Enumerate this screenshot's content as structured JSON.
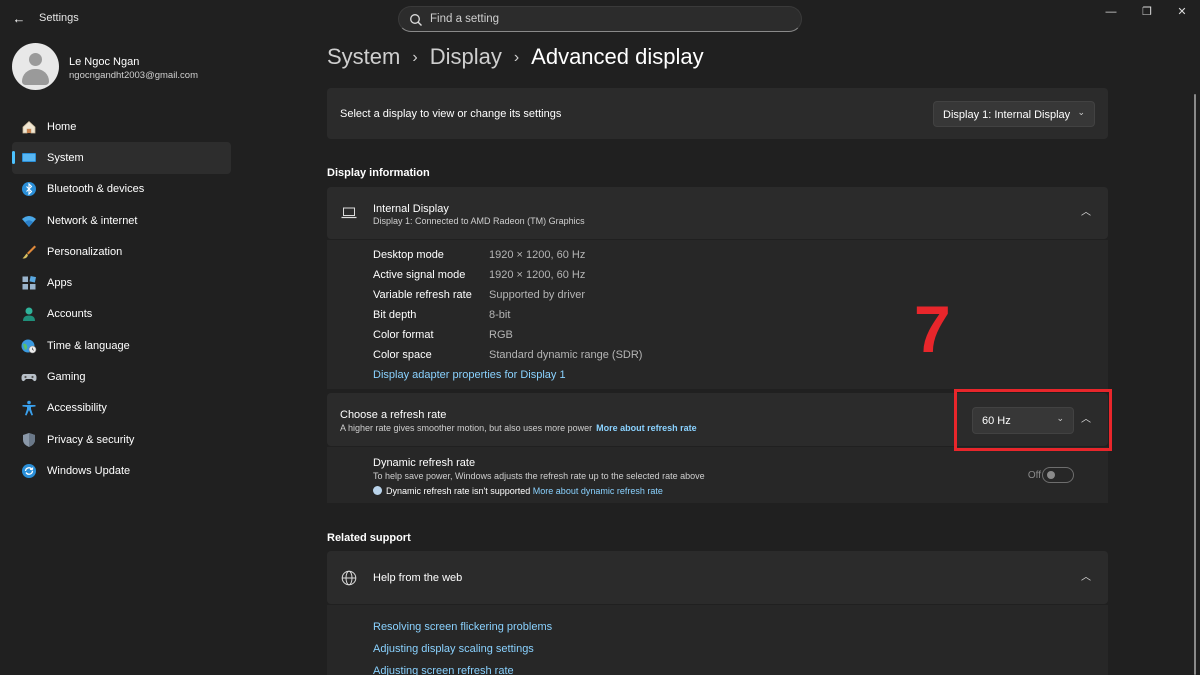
{
  "window": {
    "title": "Settings",
    "back_glyph": "←",
    "minimize_glyph": "—",
    "maximize_glyph": "❐",
    "close_glyph": "✕"
  },
  "search": {
    "placeholder": "Find a setting",
    "icon": "search-icon"
  },
  "profile": {
    "name": "Le Ngoc Ngan",
    "email": "ngocngandht2003@gmail.com"
  },
  "sidebar": {
    "items": [
      {
        "label": "Home",
        "icon": "home-icon",
        "active": false
      },
      {
        "label": "System",
        "icon": "system-icon",
        "active": true
      },
      {
        "label": "Bluetooth & devices",
        "icon": "bluetooth-icon",
        "active": false
      },
      {
        "label": "Network & internet",
        "icon": "wifi-icon",
        "active": false
      },
      {
        "label": "Personalization",
        "icon": "brush-icon",
        "active": false
      },
      {
        "label": "Apps",
        "icon": "apps-icon",
        "active": false
      },
      {
        "label": "Accounts",
        "icon": "accounts-icon",
        "active": false
      },
      {
        "label": "Time & language",
        "icon": "globe-clock-icon",
        "active": false
      },
      {
        "label": "Gaming",
        "icon": "gamepad-icon",
        "active": false
      },
      {
        "label": "Accessibility",
        "icon": "accessibility-icon",
        "active": false
      },
      {
        "label": "Privacy & security",
        "icon": "shield-icon",
        "active": false
      },
      {
        "label": "Windows Update",
        "icon": "update-icon",
        "active": false
      }
    ]
  },
  "breadcrumb": {
    "items": [
      "System",
      "Display"
    ],
    "separator": "›",
    "current": "Advanced display"
  },
  "select_display": {
    "label": "Select a display to view or change its settings",
    "value": "Display 1: Internal Display"
  },
  "display_info": {
    "section_title": "Display information",
    "name": "Internal Display",
    "subtitle": "Display 1: Connected to AMD Radeon (TM) Graphics",
    "rows": [
      {
        "key": "Desktop mode",
        "value": "1920 × 1200, 60 Hz"
      },
      {
        "key": "Active signal mode",
        "value": "1920 × 1200, 60 Hz"
      },
      {
        "key": "Variable refresh rate",
        "value": "Supported by driver"
      },
      {
        "key": "Bit depth",
        "value": "8-bit"
      },
      {
        "key": "Color format",
        "value": "RGB"
      },
      {
        "key": "Color space",
        "value": "Standard dynamic range (SDR)"
      }
    ],
    "adapter_link": "Display adapter properties for Display 1"
  },
  "refresh_rate": {
    "title": "Choose a refresh rate",
    "description": "A higher rate gives smoother motion, but also uses more power",
    "more_link": "More about refresh rate",
    "value": "60 Hz"
  },
  "dynamic_refresh": {
    "title": "Dynamic refresh rate",
    "description": "To help save power, Windows adjusts the refresh rate up to the selected rate above",
    "not_supported": "Dynamic refresh rate isn't supported",
    "more_link": "More about dynamic refresh rate",
    "toggle_label": "Off",
    "toggle_on": false
  },
  "related": {
    "section_title": "Related support",
    "help_title": "Help from the web",
    "links": [
      "Resolving screen flickering problems",
      "Adjusting display scaling settings",
      "Adjusting screen refresh rate"
    ]
  },
  "annotation": {
    "step": "7",
    "color": "#e8262b"
  },
  "colors": {
    "accent": "#4cc2ff",
    "link": "#8ad2ff",
    "background": "#202020",
    "card": "#2b2b2b"
  }
}
